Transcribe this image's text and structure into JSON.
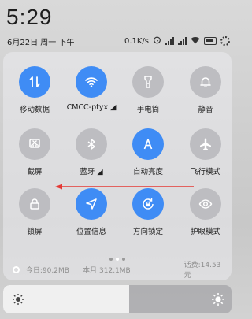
{
  "status": {
    "time": "5:29",
    "date": "6月22日 周一 下午",
    "net_speed": "0.1K/s"
  },
  "tiles": [
    {
      "label": "移动数据",
      "icon": "mobile-data-icon",
      "active": true
    },
    {
      "label": "CMCC-ptyx ◢",
      "icon": "wifi-icon",
      "active": true
    },
    {
      "label": "手电筒",
      "icon": "flashlight-icon",
      "active": false
    },
    {
      "label": "静音",
      "icon": "bell-icon",
      "active": false
    },
    {
      "label": "截屏",
      "icon": "screenshot-icon",
      "active": false
    },
    {
      "label": "蓝牙 ◢",
      "icon": "bluetooth-icon",
      "active": false
    },
    {
      "label": "自动亮度",
      "icon": "auto-brightness-icon",
      "active": true
    },
    {
      "label": "飞行模式",
      "icon": "airplane-icon",
      "active": false
    },
    {
      "label": "锁屏",
      "icon": "lock-icon",
      "active": false
    },
    {
      "label": "位置信息",
      "icon": "location-icon",
      "active": true
    },
    {
      "label": "方向锁定",
      "icon": "rotation-lock-icon",
      "active": true
    },
    {
      "label": "护眼模式",
      "icon": "eye-icon",
      "active": false
    }
  ],
  "data_usage": {
    "today": "今日:90.2MB",
    "month": "本月:312.1MB",
    "bill": "话费:14.53元"
  },
  "brightness": {
    "level": 0.55
  },
  "colors": {
    "accent": "#3f8cf5",
    "arrow": "#e53935"
  }
}
